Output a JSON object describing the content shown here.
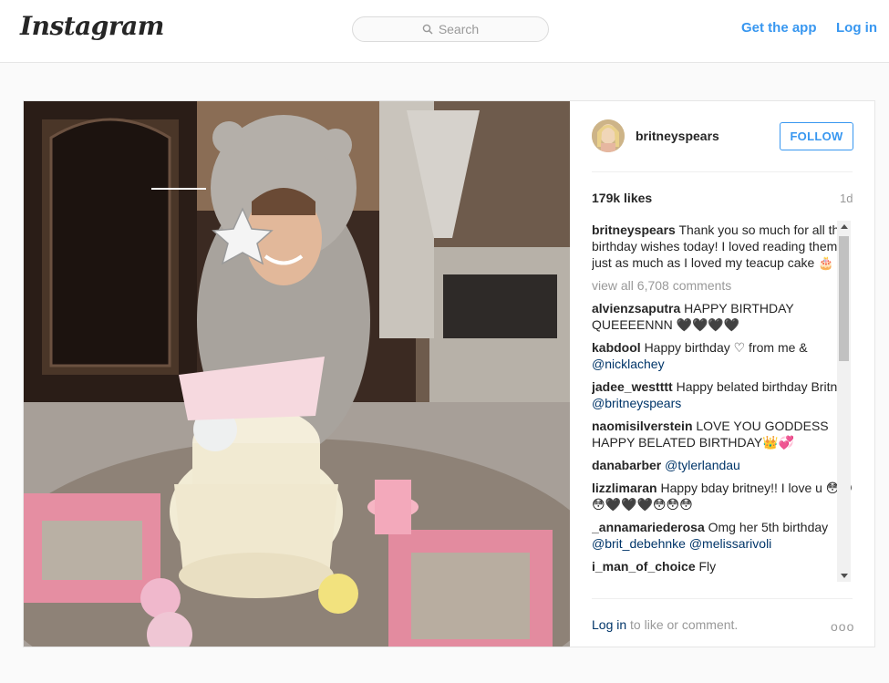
{
  "header": {
    "logo": "Instagram",
    "search_placeholder": "Search",
    "get_app": "Get the app",
    "login": "Log in"
  },
  "post": {
    "username": "britneyspears",
    "follow": "FOLLOW",
    "likes": "179k likes",
    "time": "1d",
    "caption": "Thank you so much for all the birthday wishes today! I loved reading them just as much as I loved my teacup cake 🎂",
    "view_all": "view all 6,708 comments",
    "comments": [
      {
        "user": "alvienzsaputra",
        "text": "HAPPY BIRTHDAY QUEEEENNN 🖤🖤🖤🖤",
        "mention": ""
      },
      {
        "user": "kabdool",
        "text": "Happy birthday ♡ from me & ",
        "mention": "@nicklachey"
      },
      {
        "user": "jadee_westttt",
        "text": "Happy belated birthday Britney ",
        "mention": "@britneyspears"
      },
      {
        "user": "naomisilverstein",
        "text": "LOVE YOU GODDESS HAPPY BELATED BIRTHDAY👑💞",
        "mention": ""
      },
      {
        "user": "danabarber",
        "text": "",
        "mention": "@tylerlandau"
      },
      {
        "user": "lizzlimaran",
        "text": "Happy bday britney!! I love u 😳😳😳🖤🖤🖤😳😳😳",
        "mention": ""
      },
      {
        "user": "_annamariederosa",
        "text": "Omg her 5th birthday ",
        "mention": "@brit_debehnke @melissarivoli"
      },
      {
        "user": "i_man_of_choice",
        "text": "Fly",
        "mention": ""
      }
    ],
    "login_prompt_link": "Log in",
    "login_prompt_rest": " to like or comment.",
    "more": "ooo"
  },
  "colors": {
    "accent": "#3897f0",
    "link": "#003569",
    "muted": "#999999"
  }
}
